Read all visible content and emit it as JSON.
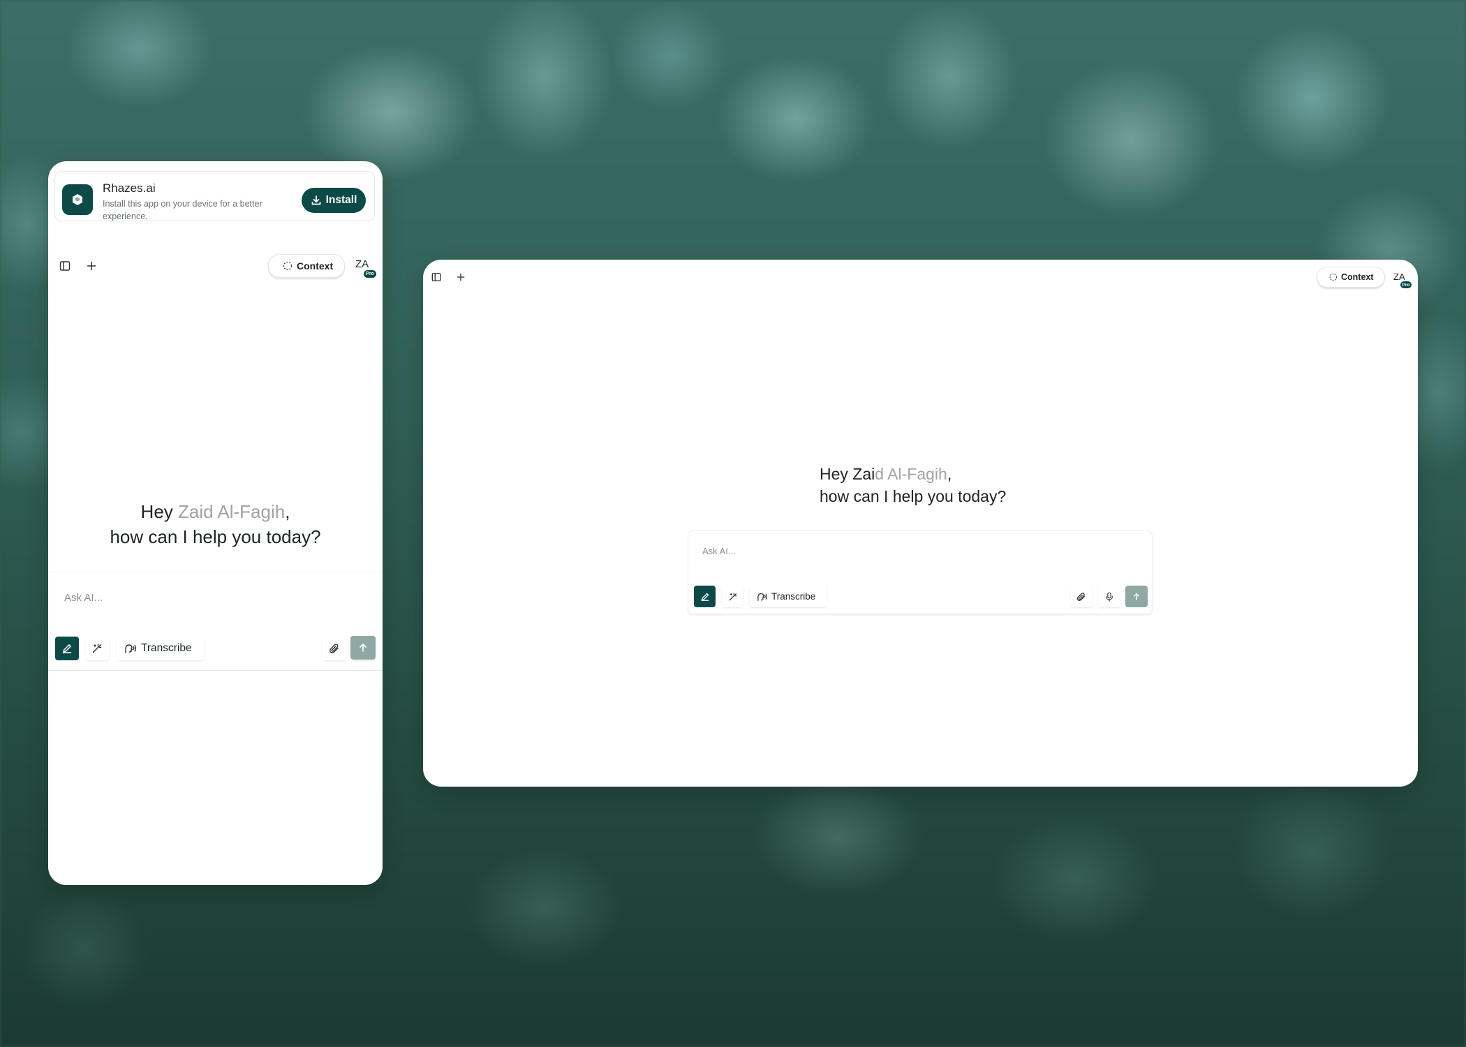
{
  "install_banner": {
    "app_name": "Rhazes.ai",
    "description": "Install this app on your device for a better experience.",
    "install_label": "Install"
  },
  "header": {
    "context_label": "Context",
    "avatar_initials": "ZA",
    "badge_label": "Pro"
  },
  "greeting": {
    "hey": "Hey",
    "name_mobile": "Zaid Al-Fagih",
    "name_desktop_dark": "Zai",
    "name_desktop_muted": "d Al-Fagih",
    "comma": ",",
    "line2": "how can I help you today?"
  },
  "composer": {
    "placeholder": "Ask AI...",
    "transcribe_label": "Transcribe"
  },
  "colors": {
    "brand": "#0d4a47",
    "send_disabled": "#8fa8a4",
    "muted_text": "#9ea4a4"
  }
}
